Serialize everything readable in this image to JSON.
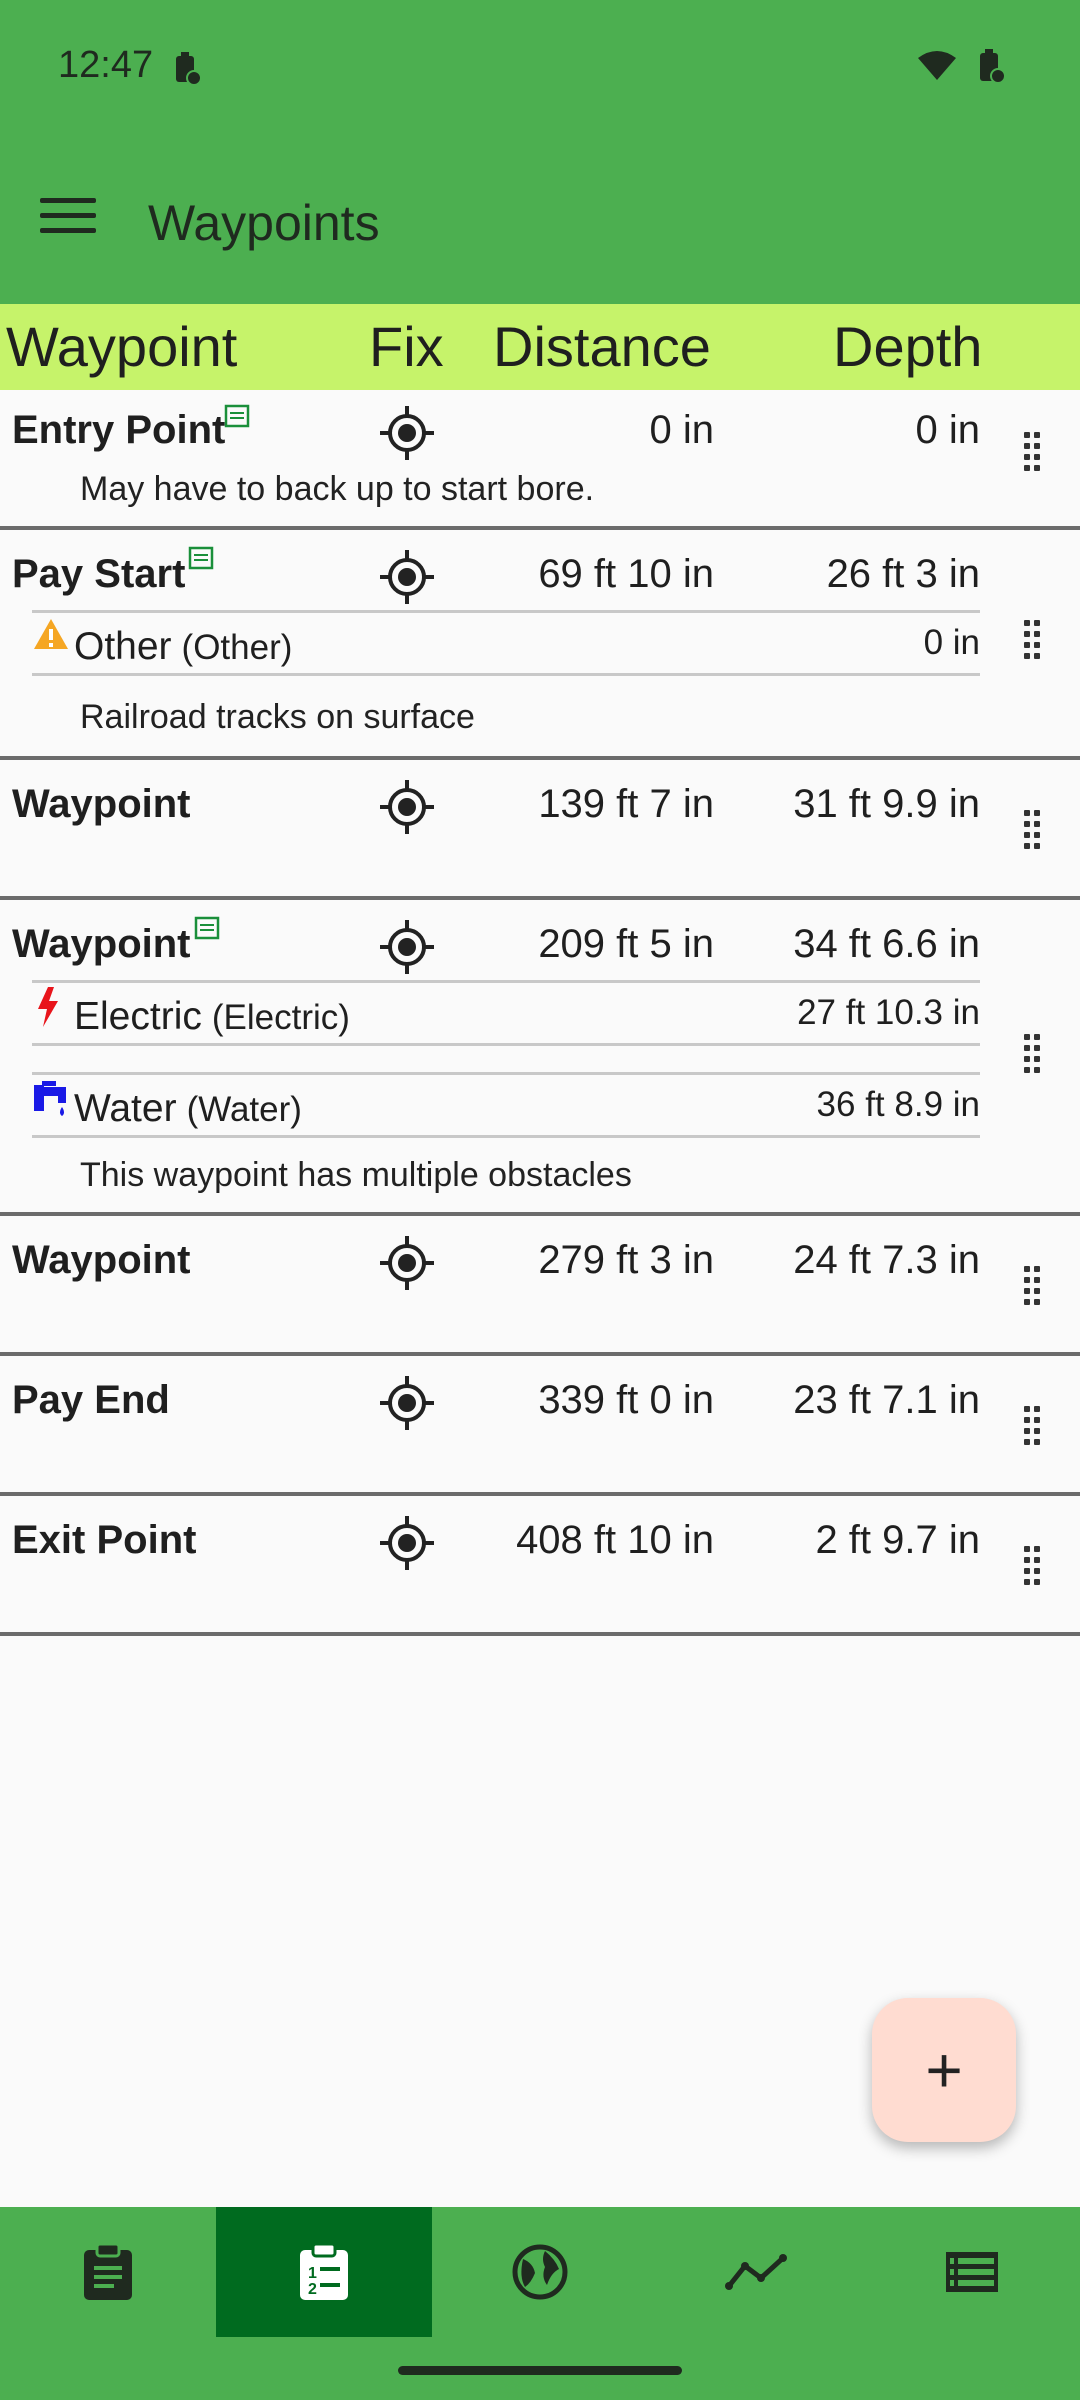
{
  "status_bar": {
    "time": "12:47"
  },
  "app_bar": {
    "title": "Waypoints"
  },
  "columns": {
    "waypoint": "Waypoint",
    "fix": "Fix",
    "distance": "Distance",
    "depth": "Depth"
  },
  "waypoints": [
    {
      "name": "Entry Point",
      "distance": "0 in",
      "depth": "0 in",
      "note": "May have to back up to start bore."
    },
    {
      "name": "Pay Start",
      "distance": "69 ft 10 in",
      "depth": "26 ft 3 in",
      "obstacles": [
        {
          "name": "Other",
          "type": "(Other)",
          "depth": "0 in",
          "icon": "warning-icon"
        }
      ],
      "note": "Railroad tracks on surface"
    },
    {
      "name": "Waypoint",
      "distance": "139 ft 7 in",
      "depth": "31 ft 9.9 in"
    },
    {
      "name": "Waypoint",
      "distance": "209 ft 5 in",
      "depth": "34 ft 6.6 in",
      "obstacles": [
        {
          "name": "Electric",
          "type": "(Electric)",
          "depth": "27 ft 10.3 in",
          "icon": "lightning-icon"
        },
        {
          "name": "Water",
          "type": "(Water)",
          "depth": "36 ft 8.9 in",
          "icon": "water-faucet-icon"
        }
      ],
      "note": "This waypoint has multiple obstacles"
    },
    {
      "name": "Waypoint",
      "distance": "279 ft 3 in",
      "depth": "24 ft 7.3 in"
    },
    {
      "name": "Pay End",
      "distance": "339 ft 0 in",
      "depth": "23 ft 7.1 in"
    },
    {
      "name": "Exit Point",
      "distance": "408 ft 10 in",
      "depth": "2 ft 9.7 in"
    }
  ],
  "fab": {
    "label": "+"
  },
  "bottom_nav": [
    {
      "icon": "clipboard-icon",
      "active": false
    },
    {
      "icon": "clipboard-list-icon",
      "active": true
    },
    {
      "icon": "globe-icon",
      "active": false
    },
    {
      "icon": "line-chart-icon",
      "active": false
    },
    {
      "icon": "table-list-icon",
      "active": false
    }
  ],
  "colors": {
    "primary": "#4caf50",
    "header": "#c6f36a",
    "active_nav": "#006b1f",
    "fab": "#ffdcd1"
  }
}
